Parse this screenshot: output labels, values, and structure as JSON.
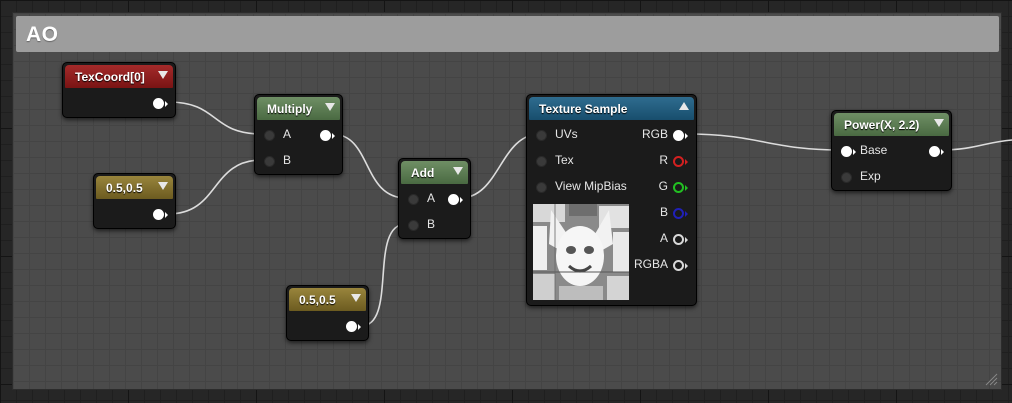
{
  "comment": {
    "title": "AO"
  },
  "nodes": {
    "texcoord": {
      "title": "TexCoord[0]"
    },
    "multiply": {
      "title": "Multiply",
      "pin_a": "A",
      "pin_b": "B"
    },
    "const1": {
      "title": "0.5,0.5"
    },
    "add": {
      "title": "Add",
      "pin_a": "A",
      "pin_b": "B"
    },
    "const2": {
      "title": "0.5,0.5"
    },
    "texture_sample": {
      "title": "Texture Sample",
      "inputs": [
        "UVs",
        "Tex",
        "View MipBias"
      ],
      "outputs": [
        "RGB",
        "R",
        "G",
        "B",
        "A",
        "RGBA"
      ]
    },
    "power": {
      "title": "Power(X, 2.2)",
      "pin_base": "Base",
      "pin_exp": "Exp"
    }
  },
  "colors": {
    "header_red": "#8f1f1f",
    "header_green": "#5c7c53",
    "header_yellow": "#83702d",
    "header_blue": "#236080",
    "pin_r": "#d42020",
    "pin_g": "#22c022",
    "pin_b": "#2020b8"
  }
}
